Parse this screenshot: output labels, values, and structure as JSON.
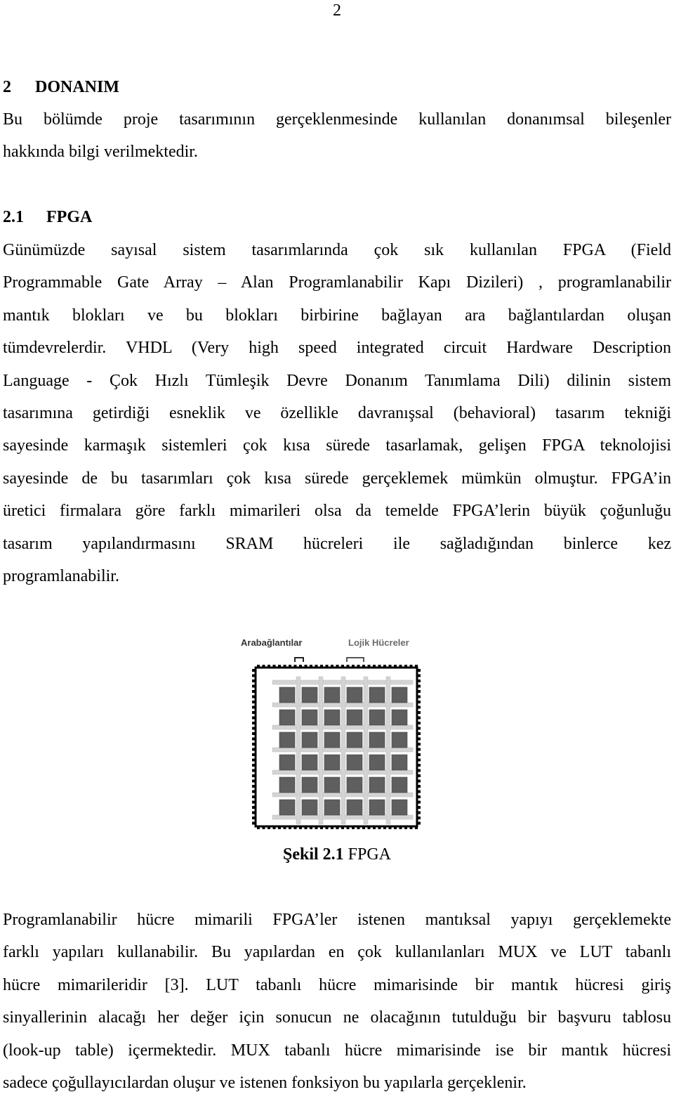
{
  "page_number": "2",
  "chapter": {
    "number": "2",
    "title": "DONANIM"
  },
  "intro_paragraph_lines": [
    "Bu bölümde proje tasarımının gerçeklenmesinde kullanılan donanımsal bileşenler",
    "hakkında bilgi verilmektedir."
  ],
  "section": {
    "number": "2.1",
    "title": "FPGA"
  },
  "section_paragraph_lines": [
    "Günümüzde sayısal sistem tasarımlarında çok sık kullanılan FPGA (Field",
    "Programmable Gate Array – Alan Programlanabilir Kapı Dizileri) , programlanabilir",
    "mantık blokları ve bu blokları birbirine bağlayan ara bağlantılardan oluşan",
    "tümdevrelerdir. VHDL (Very high speed integrated circuit Hardware Description",
    "Language - Çok Hızlı Tümleşik Devre Donanım Tanımlama Dili) dilinin sistem",
    "tasarımına getirdiği esneklik ve özellikle davranışsal (behavioral) tasarım tekniği",
    "sayesinde karmaşık sistemleri çok kısa sürede tasarlamak, gelişen FPGA teknolojisi",
    "sayesinde de bu tasarımları çok kısa sürede gerçeklemek mümkün olmuştur. FPGA’in",
    "üretici firmalara göre farklı mimarileri olsa da temelde FPGA’lerin büyük çoğunluğu",
    "tasarım yapılandırmasını SRAM hücreleri ile sağladığından binlerce kez",
    "programlanabilir."
  ],
  "figure": {
    "label_interconnects": "Arabağlantılar",
    "label_logic_cells": "Lojik Hücreler",
    "grid_rows": 6,
    "grid_cols": 6,
    "colors": {
      "logic_cell": "#5f5f5f",
      "interconnect": "#d4d4d4",
      "border_pins": "#000000"
    },
    "caption_prefix": "Şekil 2.1",
    "caption_text": " FPGA"
  },
  "closing_paragraph_lines": [
    "Programlanabilir hücre mimarili FPGA’ler istenen mantıksal yapıyı gerçeklemekte",
    "farklı yapıları kullanabilir. Bu yapılardan en çok kullanılanları MUX ve LUT tabanlı",
    "hücre mimarileridir [3]. LUT tabanlı hücre mimarisinde bir mantık hücresi giriş",
    "sinyallerinin alacağı her değer için sonucun ne olacağının tutulduğu bir başvuru tablosu",
    "(look-up table) içermektedir. MUX tabanlı hücre mimarisinde ise bir mantık hücresi",
    "sadece çoğullayıcılardan oluşur ve istenen fonksiyon bu yapılarla gerçeklenir."
  ]
}
